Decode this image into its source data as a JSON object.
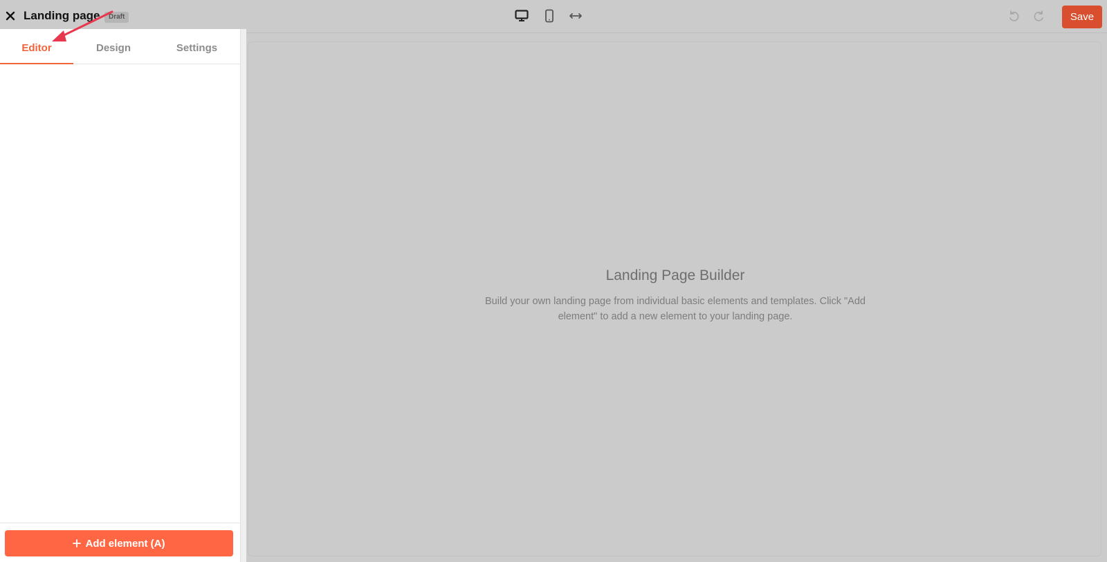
{
  "header": {
    "title": "Landing page",
    "badge": "Draft",
    "save_label": "Save",
    "close_icon": "close-icon",
    "view_icons": [
      "desktop-icon",
      "mobile-icon",
      "fullwidth-icon"
    ],
    "history_icons": [
      "undo-icon",
      "redo-icon"
    ]
  },
  "sidebar": {
    "tabs": [
      {
        "label": "Editor",
        "active": true
      },
      {
        "label": "Design",
        "active": false
      },
      {
        "label": "Settings",
        "active": false
      }
    ],
    "add_button_label": "Add element (A)",
    "add_icon": "plus-icon"
  },
  "canvas": {
    "title": "Landing Page Builder",
    "description": "Build your own landing page from individual basic elements and templates. Click \"Add element\" to add a new element to your landing page."
  },
  "colors": {
    "accent": "#f0643c",
    "save_button": "#d84e2e",
    "add_button": "#ff6644",
    "annotation": "#e8384f"
  }
}
